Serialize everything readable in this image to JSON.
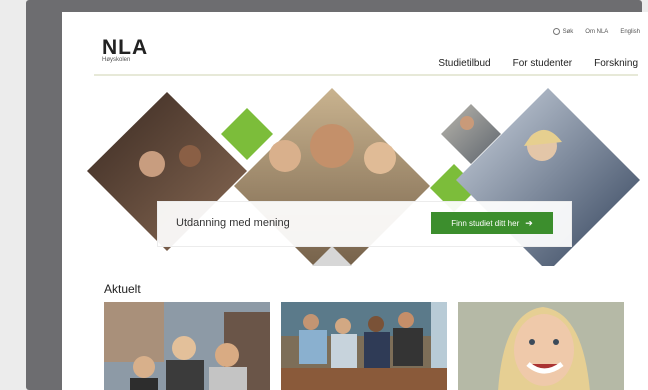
{
  "top_links": {
    "search": "Søk",
    "about": "Om NLA",
    "english": "English"
  },
  "logo": {
    "mark": "NLA",
    "sub": "Høyskolen"
  },
  "nav": [
    {
      "label": "Studietilbud"
    },
    {
      "label": "For studenter"
    },
    {
      "label": "Forskning"
    }
  ],
  "hero": {
    "tagline": "Utdanning med mening",
    "cta": "Finn studiet ditt her",
    "cta_icon": "arrow-right-icon",
    "accent_color": "#7cbd3a",
    "button_color": "#3c8e2d"
  },
  "news": {
    "heading": "Aktuelt"
  }
}
